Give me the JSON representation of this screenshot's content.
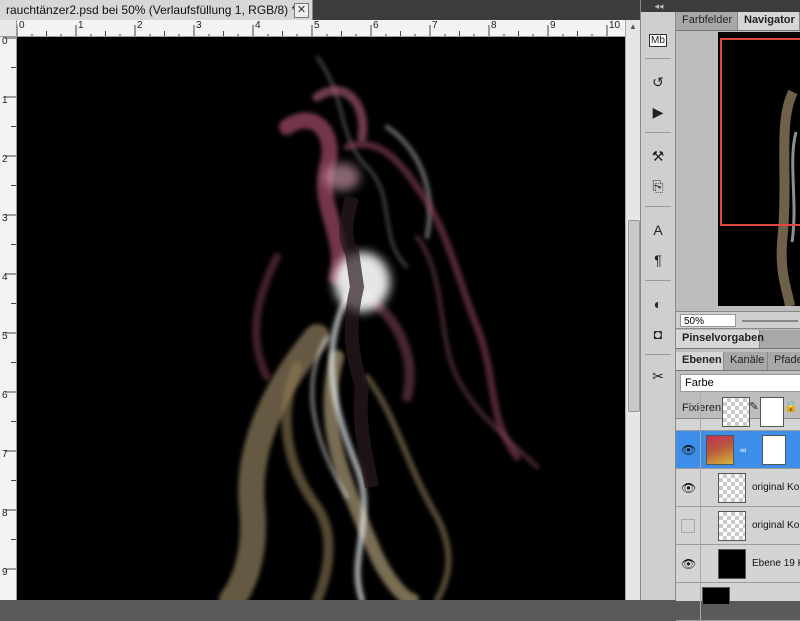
{
  "document": {
    "tab_title": "rauchtänzer2.psd bei 50% (Verlaufsfüllung 1, RGB/8) *",
    "close_glyph": "✕",
    "ruler_top_labels": [
      "0",
      "1",
      "2",
      "3",
      "4",
      "5",
      "6",
      "7",
      "8",
      "9",
      "10"
    ],
    "ruler_left_labels": [
      "0",
      "1",
      "2",
      "3",
      "4",
      "5",
      "6",
      "7",
      "8",
      "9"
    ]
  },
  "dock": {
    "collapse_glyph": "◂◂",
    "tools": [
      {
        "icon": "mini-bridge-icon",
        "glyph": "Mb"
      },
      {
        "icon": "history-icon",
        "glyph": "↺"
      },
      {
        "icon": "actions-icon",
        "glyph": "▶"
      },
      {
        "icon": "tool-presets-icon",
        "glyph": "⚒"
      },
      {
        "icon": "clone-source-icon",
        "glyph": "⎘"
      },
      {
        "icon": "character-icon",
        "glyph": "A"
      },
      {
        "icon": "paragraph-icon",
        "glyph": "¶"
      },
      {
        "icon": "adjustments-icon",
        "glyph": "◐"
      },
      {
        "icon": "masks-icon",
        "glyph": "◘"
      },
      {
        "icon": "tools-icon",
        "glyph": "✂"
      }
    ]
  },
  "navigator": {
    "tabs": [
      "Farbfelder",
      "Navigator"
    ],
    "active_tab": "Navigator",
    "zoom": "50%",
    "frame_color": "#e0463f"
  },
  "brush_panel": {
    "tab": "Pinselvorgaben"
  },
  "layers_panel": {
    "tabs": [
      "Ebenen",
      "Kanäle",
      "Pfade"
    ],
    "active_tab": "Ebenen",
    "blend_mode": "Farbe",
    "lock_label": "Fixieren:",
    "lock_icons": [
      "lock-transparency-icon",
      "lock-paint-icon",
      "lock-position-icon",
      "lock-all-icon"
    ],
    "lock_glyphs": [
      "▦",
      "✎",
      "✥",
      "🔒"
    ],
    "layers": [
      {
        "name": "original Ko",
        "visible": true,
        "selected": false
      },
      {
        "name": "original Ko",
        "visible": false,
        "selected": false
      },
      {
        "name": "Ebene 19 K",
        "visible": true,
        "selected": false
      }
    ],
    "eye_glyph": "👁",
    "chain_glyph": "∞"
  },
  "colors": {
    "selection": "#3d8ee8",
    "smoke_magenta": "#b0516f",
    "smoke_gold": "#c9b68b",
    "smoke_white": "#e8eef2"
  }
}
